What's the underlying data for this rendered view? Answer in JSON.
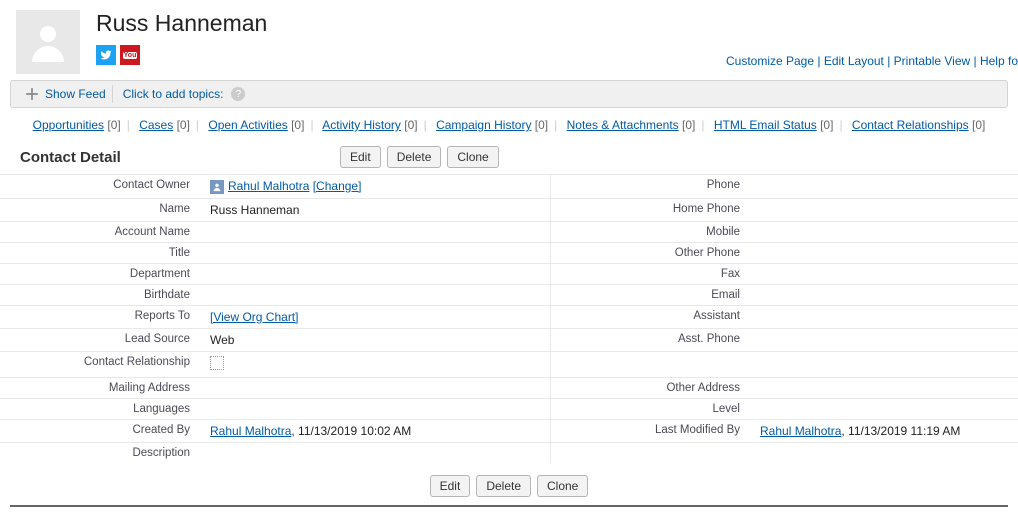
{
  "header": {
    "title": "Russ Hanneman",
    "top_links": {
      "customize": "Customize Page",
      "edit_layout": "Edit Layout",
      "printable": "Printable View",
      "help": "Help fo"
    }
  },
  "toolbar": {
    "show_feed": "Show Feed",
    "add_topics": "Click to add topics:"
  },
  "related": [
    {
      "label": "Opportunities",
      "count": "[0]"
    },
    {
      "label": "Cases",
      "count": "[0]"
    },
    {
      "label": "Open Activities",
      "count": "[0]"
    },
    {
      "label": "Activity History",
      "count": "[0]"
    },
    {
      "label": "Campaign History",
      "count": "[0]"
    },
    {
      "label": "Notes & Attachments",
      "count": "[0]"
    },
    {
      "label": "HTML Email Status",
      "count": "[0]"
    },
    {
      "label": "Contact Relationships",
      "count": "[0]"
    }
  ],
  "section": {
    "title": "Contact Detail"
  },
  "buttons": {
    "edit": "Edit",
    "delete": "Delete",
    "clone": "Clone"
  },
  "fields": {
    "contact_owner": {
      "lbl": "Contact Owner",
      "owner": "Rahul Malhotra",
      "change": "[Change]"
    },
    "phone": {
      "lbl": "Phone"
    },
    "name": {
      "lbl": "Name",
      "val": "Russ Hanneman"
    },
    "home_phone": {
      "lbl": "Home Phone"
    },
    "account_name": {
      "lbl": "Account Name"
    },
    "mobile": {
      "lbl": "Mobile"
    },
    "title": {
      "lbl": "Title"
    },
    "other_phone": {
      "lbl": "Other Phone"
    },
    "department": {
      "lbl": "Department"
    },
    "fax": {
      "lbl": "Fax"
    },
    "birthdate": {
      "lbl": "Birthdate"
    },
    "email": {
      "lbl": "Email"
    },
    "reports_to": {
      "lbl": "Reports To",
      "link": "[View Org Chart]"
    },
    "assistant": {
      "lbl": "Assistant"
    },
    "lead_source": {
      "lbl": "Lead Source",
      "val": "Web"
    },
    "asst_phone": {
      "lbl": "Asst. Phone"
    },
    "contact_rel": {
      "lbl": "Contact Relationship"
    },
    "mailing_addr": {
      "lbl": "Mailing Address"
    },
    "other_addr": {
      "lbl": "Other Address"
    },
    "languages": {
      "lbl": "Languages"
    },
    "level": {
      "lbl": "Level"
    },
    "created_by": {
      "lbl": "Created By",
      "user": "Rahul Malhotra",
      "ts": ", 11/13/2019 10:02 AM"
    },
    "modified_by": {
      "lbl": "Last Modified By",
      "user": "Rahul Malhotra",
      "ts": ", 11/13/2019 11:19 AM"
    },
    "description": {
      "lbl": "Description"
    }
  }
}
